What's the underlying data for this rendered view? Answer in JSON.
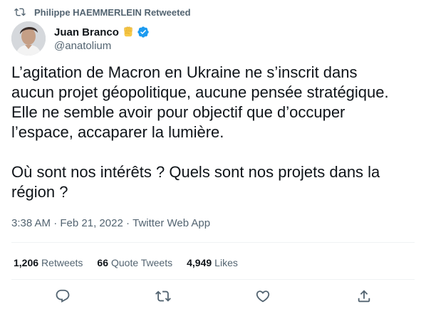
{
  "retweet_header": {
    "icon": "retweet-icon",
    "text": "Philippe HAEMMERLEIN Retweeted"
  },
  "author": {
    "name": "Juan Branco",
    "handle": "@anatolium",
    "emoji": "raised-fist-emoji",
    "verified_icon": "verified-badge-icon",
    "verified_color": "#1d9bf0"
  },
  "tweet": {
    "paragraph1": [
      "L’agitation de Macron en Ukraine ne s’inscrit dans",
      "aucun projet géopolitique, aucune pensée stratégique.",
      "Elle ne semble avoir pour objectif que d’occuper",
      "l’espace, accaparer la lumière."
    ],
    "paragraph2": [
      "Où sont nos intérêts ? Quels sont nos projets dans la",
      "région ?"
    ]
  },
  "meta": {
    "time": "3:38 AM",
    "separator": " · ",
    "date": "Feb 21, 2022",
    "source": "Twitter Web App"
  },
  "stats": {
    "retweets_count": "1,206",
    "retweets_label": "Retweets",
    "quotes_count": "66",
    "quotes_label": "Quote Tweets",
    "likes_count": "4,949",
    "likes_label": "Likes"
  },
  "actions": [
    "reply-icon",
    "retweet-icon",
    "like-icon",
    "share-icon"
  ],
  "colors": {
    "text": "#0f1419",
    "secondary": "#536471",
    "divider": "#eff3f4"
  }
}
